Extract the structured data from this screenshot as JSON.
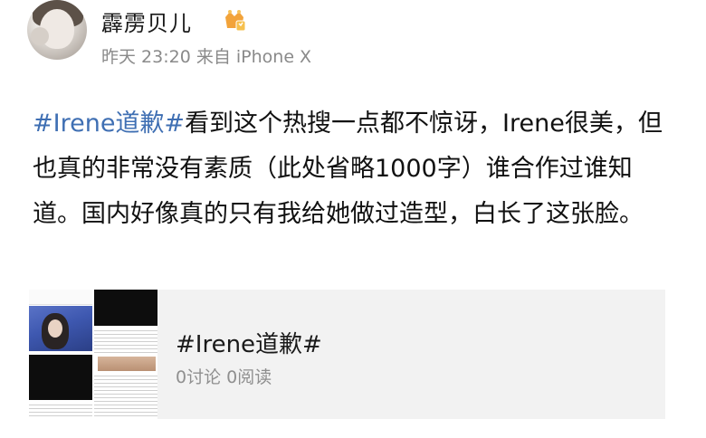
{
  "post": {
    "username": "霹雳贝儿",
    "meta": "昨天 23:20 来自 iPhone X",
    "hashtag": "#Irene道歉#",
    "body": "看到这个热搜一点都不惊讶，Irene很美，但也真的非常没有素质（此处省略1000字）谁合作过谁知道。国内好像真的只有我给她做过造型，白长了这张脸。"
  },
  "card": {
    "title": "#Irene道歉#",
    "stats": "0讨论 0阅读"
  },
  "colors": {
    "hashtag": "#3f6fb3",
    "meta": "#8a8a8a",
    "card_bg": "#f2f2f2",
    "vip_badge": "#f2a33a"
  },
  "icons": {
    "vip": "vip-crown-icon"
  }
}
